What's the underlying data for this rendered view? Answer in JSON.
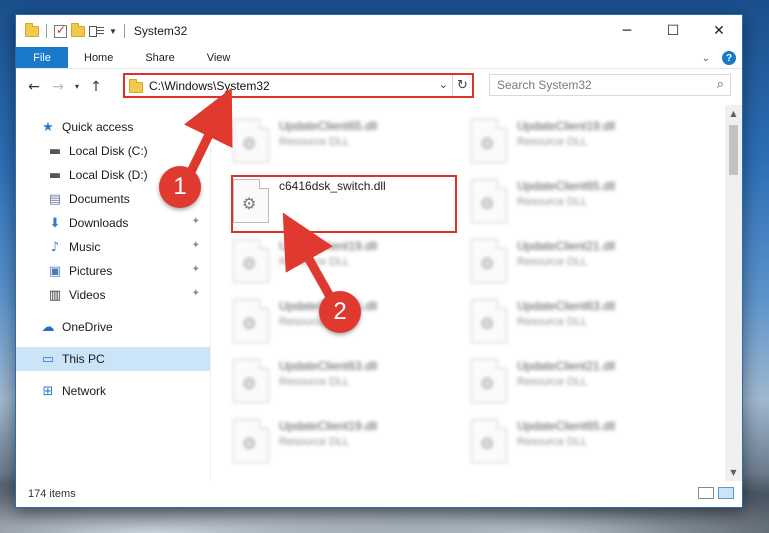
{
  "window": {
    "title": "System32",
    "controls": {
      "minimize": "─",
      "maximize": "☐",
      "close": "✕"
    }
  },
  "ribbon": {
    "tabs": [
      "File",
      "Home",
      "Share",
      "View"
    ],
    "collapse_icon": "chevron-down-icon",
    "help_icon": "?"
  },
  "address": {
    "path": "C:\\Windows\\System32",
    "search_placeholder": "Search System32"
  },
  "sidebar": {
    "quick_access": "Quick access",
    "items": [
      {
        "label": "Local Disk (C:)",
        "icon": "drive-icon",
        "pinned": false
      },
      {
        "label": "Local Disk (D:)",
        "icon": "drive-icon",
        "pinned": false
      },
      {
        "label": "Documents",
        "icon": "documents-icon",
        "pinned": true
      },
      {
        "label": "Downloads",
        "icon": "downloads-icon",
        "pinned": true
      },
      {
        "label": "Music",
        "icon": "music-icon",
        "pinned": true
      },
      {
        "label": "Pictures",
        "icon": "pictures-icon",
        "pinned": true
      },
      {
        "label": "Videos",
        "icon": "videos-icon",
        "pinned": true
      }
    ],
    "onedrive": "OneDrive",
    "this_pc": "This PC",
    "network": "Network"
  },
  "files": {
    "left_column": [
      {
        "name": "UpdateClient65.dll",
        "type": "Resource DLL",
        "blurred": true
      },
      {
        "name": "c6416dsk_switch.dll",
        "type": "",
        "blurred": false
      },
      {
        "name": "UpdateClient19.dll",
        "type": "Resource DLL",
        "blurred": true
      },
      {
        "name": "UpdateClient65.dll",
        "type": "Resource DLL",
        "blurred": true
      },
      {
        "name": "UpdateClient63.dll",
        "type": "Resource DLL",
        "blurred": true
      },
      {
        "name": "UpdateClient19.dll",
        "type": "Resource DLL",
        "blurred": true
      }
    ],
    "right_column": [
      {
        "name": "UpdateClient19.dll",
        "type": "Resource DLL",
        "blurred": true
      },
      {
        "name": "UpdateClient65.dll",
        "type": "Resource DLL",
        "blurred": true
      },
      {
        "name": "UpdateClient21.dll",
        "type": "Resource DLL",
        "blurred": true
      },
      {
        "name": "UpdateClient63.dll",
        "type": "Resource DLL",
        "blurred": true
      },
      {
        "name": "UpdateClient21.dll",
        "type": "Resource DLL",
        "blurred": true
      },
      {
        "name": "UpdateClient65.dll",
        "type": "Resource DLL",
        "blurred": true
      }
    ]
  },
  "status": {
    "item_count": "174 items"
  },
  "annotations": {
    "step1": "1",
    "step2": "2",
    "color": "#e0392f"
  }
}
